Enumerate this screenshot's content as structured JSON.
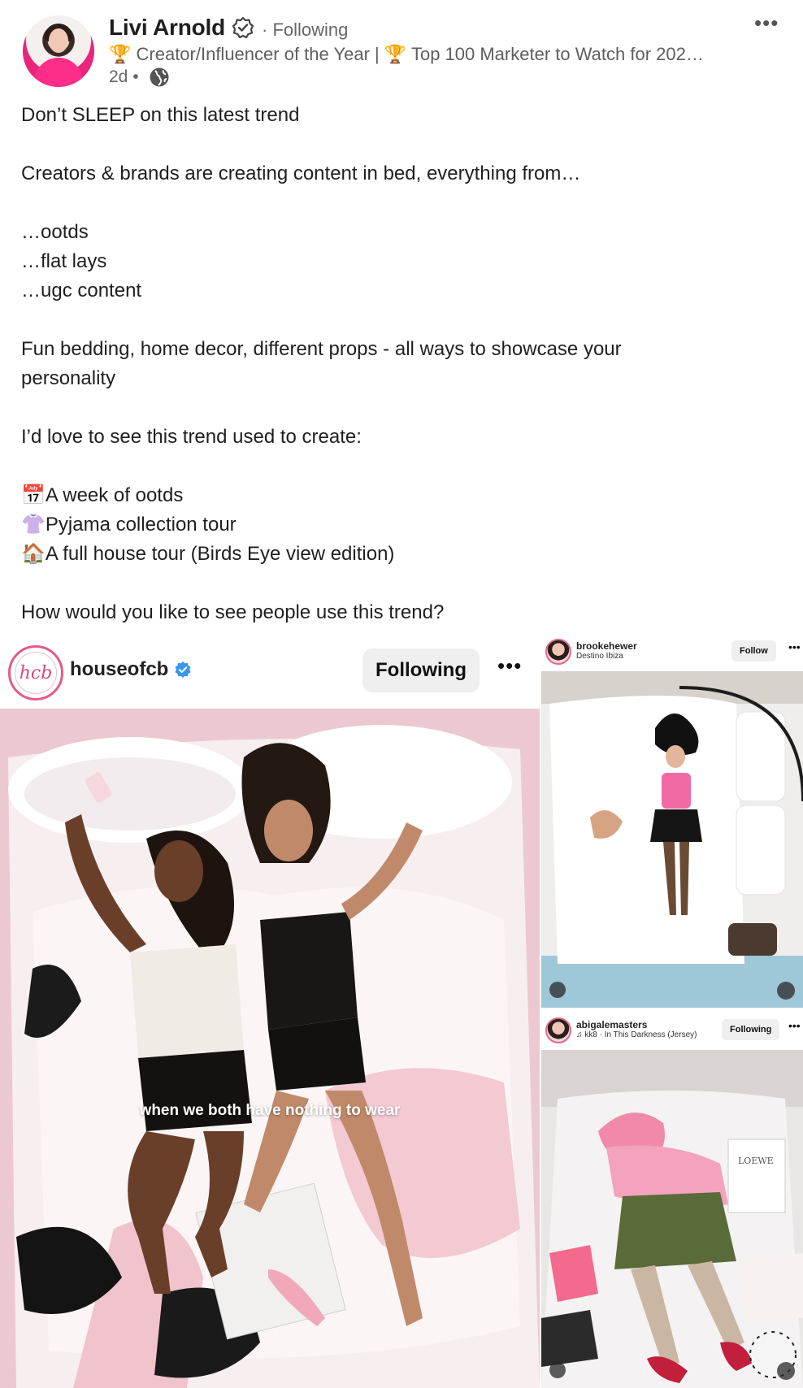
{
  "author": {
    "name": "Livi Arnold",
    "following": "· Following",
    "headline": "🏆 Creator/Influencer of the Year | 🏆 Top 100 Marketer to Watch for 202…",
    "meta": "2d •"
  },
  "post": {
    "lines": [
      "Don’t SLEEP on this latest trend",
      "",
      "Creators & brands are creating content in bed, everything from…",
      "",
      "…ootds",
      "…flat lays",
      "…ugc content",
      "",
      "Fun bedding, home decor, different props - all ways to showcase your",
      "personality",
      "",
      "I’d love to see this trend used to create:",
      "",
      "📅A week of ootds",
      "👚Pyjama collection tour",
      "🏠A full house tour (Birds Eye view edition)",
      "",
      "How would you like to see people use this trend?"
    ]
  },
  "media": {
    "left": {
      "account": "houseofcb",
      "logo_text": "hcb",
      "button": "Following",
      "caption": "when we both have nothing to wear"
    },
    "right_top": {
      "account": "brookehewer",
      "sub": "Destino Ibiza",
      "button": "Follow"
    },
    "right_bottom": {
      "account": "abigalemasters",
      "sub": "♫ kk8 · In This Darkness (Jersey)",
      "button": "Following",
      "box_text": "LOEWE"
    }
  },
  "colors": {
    "accent_pink": "#e55a8a",
    "verified_blue": "#3897f0",
    "text": "#1f1f1f",
    "muted": "#666666"
  }
}
